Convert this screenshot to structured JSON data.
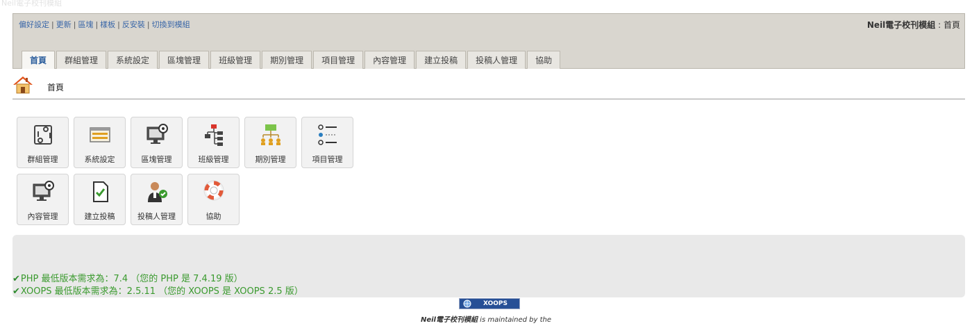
{
  "ghost_title": "Neil電子校刊模組",
  "quicklinks": [
    "偏好設定",
    "更新",
    "區塊",
    "樣板",
    "反安裝",
    "切換到模組"
  ],
  "module_title": {
    "name": "Neil電子校刊模組",
    "sep": " : ",
    "page": "首頁"
  },
  "tabs": [
    "首頁",
    "群組管理",
    "系統設定",
    "區塊管理",
    "班級管理",
    "期別管理",
    "項目管理",
    "內容管理",
    "建立投稿",
    "投稿人管理",
    "協助"
  ],
  "breadcrumb": {
    "text": "首頁"
  },
  "cards": [
    {
      "label": "群組管理",
      "icon": "group-sync-icon"
    },
    {
      "label": "系統設定",
      "icon": "settings-panel-icon"
    },
    {
      "label": "區塊管理",
      "icon": "monitor-gear-icon"
    },
    {
      "label": "班級管理",
      "icon": "hierarchy-icon"
    },
    {
      "label": "期別管理",
      "icon": "org-chart-icon"
    },
    {
      "label": "項目管理",
      "icon": "list-icon"
    },
    {
      "label": "內容管理",
      "icon": "monitor-gear-icon"
    },
    {
      "label": "建立投稿",
      "icon": "document-check-icon"
    },
    {
      "label": "投稿人管理",
      "icon": "user-check-icon"
    },
    {
      "label": "協助",
      "icon": "lifebuoy-icon"
    }
  ],
  "requirements": [
    "PHP 最低版本需求為：7.4 （您的 PHP 是 7.4.19 版）",
    "XOOPS 最低版本需求為：2.5.11 （您的 XOOPS 是 XOOPS 2.5 版）"
  ],
  "badge": {
    "text": "XOOPS"
  },
  "footer": {
    "name": "Neil電子校刊模組",
    "rest": " is maintained by the"
  },
  "colors": {
    "header_bg": "#d9d6cf",
    "link": "#3a67a8",
    "ok_green": "#3a9a2e",
    "badge_bg": "#264f96"
  }
}
